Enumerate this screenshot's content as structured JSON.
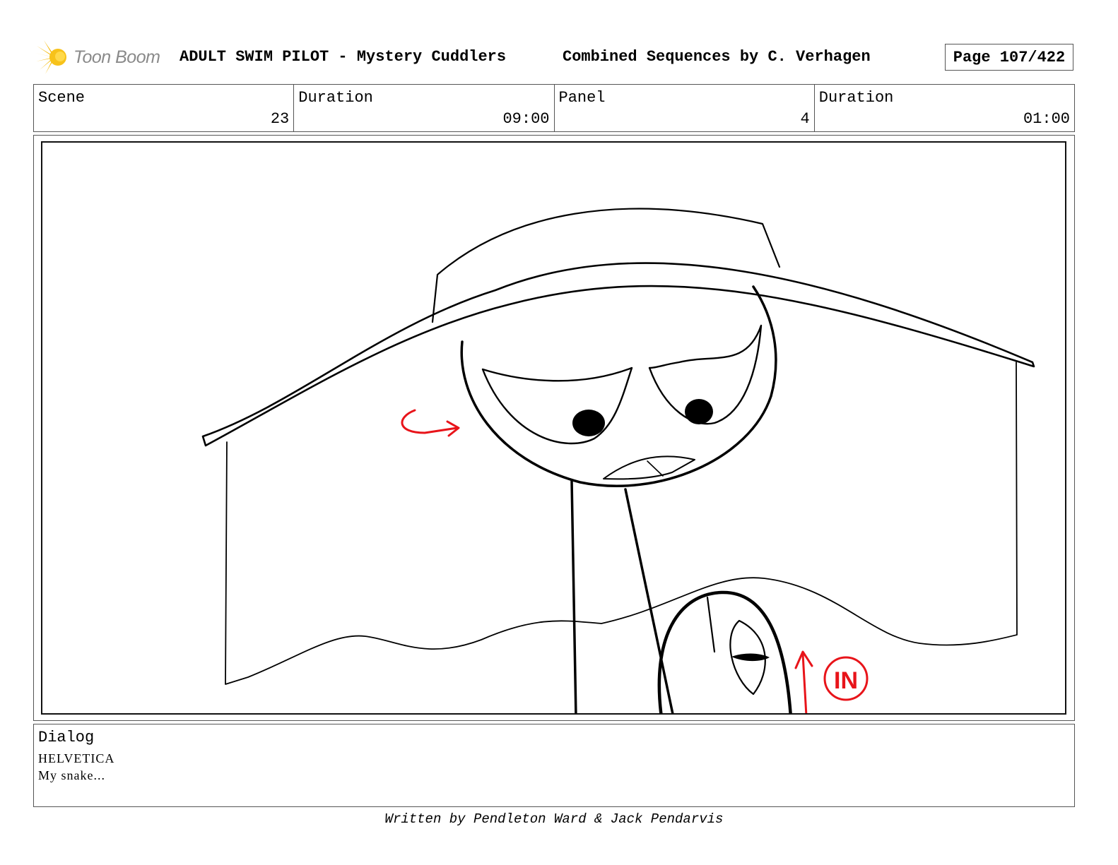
{
  "header": {
    "logo_text": "Toon Boom",
    "title": "ADULT SWIM PILOT - Mystery Cuddlers",
    "subtitle": "Combined Sequences by C. Verhagen",
    "page": "Page 107/422"
  },
  "info": {
    "scene_label": "Scene",
    "scene_value": "23",
    "scene_duration_label": "Duration",
    "scene_duration_value": "09:00",
    "panel_label": "Panel",
    "panel_value": "4",
    "panel_duration_label": "Duration",
    "panel_duration_value": "01:00"
  },
  "panel": {
    "annotation_in": "IN",
    "stroke_color": "#000000",
    "annotation_color": "#e8141a"
  },
  "dialog": {
    "label": "Dialog",
    "character": "HELVETICA",
    "line": "My snake..."
  },
  "footer": {
    "credit": "Written by Pendleton Ward & Jack Pendarvis"
  },
  "colors": {
    "logo_yellow": "#f5b800",
    "logo_text": "#8a8a8a",
    "border": "#555555"
  }
}
